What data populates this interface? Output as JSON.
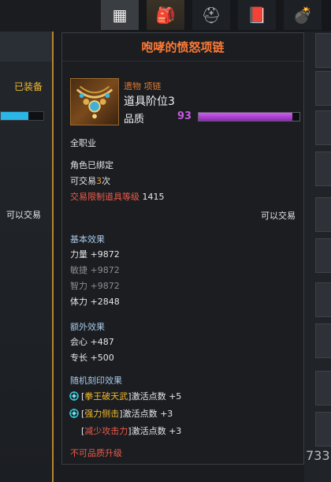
{
  "left_panel": {
    "equipped_label": "已装备",
    "trade_label": "可以交易",
    "bar_fill_fraction": 0.64
  },
  "top_tabs": [
    {
      "name": "grid-icon"
    },
    {
      "name": "backpack-icon"
    },
    {
      "name": "hat-icon"
    },
    {
      "name": "book-icon"
    },
    {
      "name": "bomb-icon"
    }
  ],
  "tooltip": {
    "title": "咆哮的愤怒项链",
    "item_type": "遗物 项链",
    "tier": "道具阶位3",
    "quality_label": "品质",
    "quality_value": "93",
    "quality_fraction": 0.93,
    "class_req": "全职业",
    "bound": "角色已绑定",
    "tradable_prefix": "可交易",
    "tradable_count": "3",
    "tradable_suffix": "次",
    "trade_limit_label": "交易限制道具等级",
    "trade_limit_value": "1415",
    "can_trade": "可以交易",
    "basic_effect_title": "基本效果",
    "basic_stats": [
      {
        "label": "力量 +9872",
        "dim": false
      },
      {
        "label": "敏捷 +9872",
        "dim": true
      },
      {
        "label": "智力 +9872",
        "dim": true
      },
      {
        "label": "体力 +2848",
        "dim": false
      }
    ],
    "extra_effect_title": "额外效果",
    "extra_stats": [
      "会心 +487",
      "专长 +500"
    ],
    "engrave_title": "随机刻印效果",
    "engravings": [
      {
        "open": "[",
        "name": "拳王破天武",
        "close": "]",
        "suffix": "激活点数 +5",
        "color": "gold",
        "icon": "gem-icon"
      },
      {
        "open": "[",
        "name": "强力侧击",
        "close": "]",
        "suffix": "激活点数 +3",
        "color": "gold",
        "icon": "gem-icon"
      },
      {
        "open": "[",
        "name": "减少攻击力",
        "close": "]",
        "suffix": "激活点数 +3",
        "color": "red",
        "icon": ""
      }
    ],
    "no_upgrade": "不可品质升级"
  },
  "right_panel": {
    "number": "733"
  }
}
